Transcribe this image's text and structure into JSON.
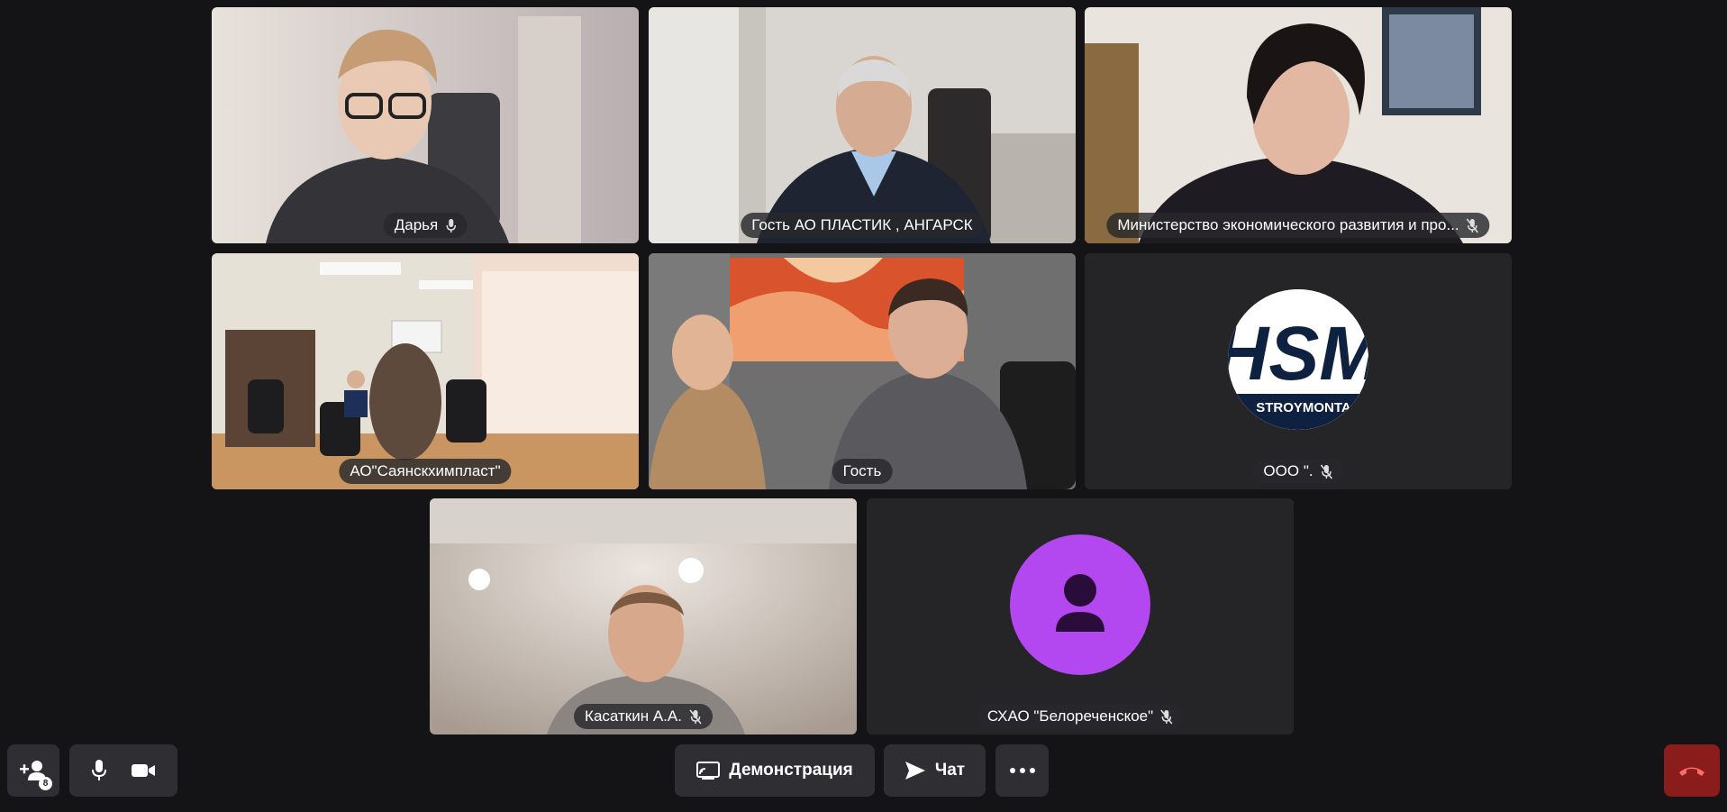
{
  "tiles": [
    {
      "name": "Дарья",
      "mic": "mic-on"
    },
    {
      "name": "Гость АО ПЛАСТИК , АНГАРСК",
      "mic": "none"
    },
    {
      "name": "Министерство экономического развития и про...",
      "mic": "mic-muted"
    },
    {
      "name": "АО\"Саянскхимпласт\"",
      "mic": "none"
    },
    {
      "name": "Гость",
      "mic": "none",
      "speaking": true
    },
    {
      "name": "ООО \".",
      "mic": "mic-muted",
      "avatar_logo_text": "HSM",
      "avatar_logo_subtext": "STROYMONTA"
    },
    {
      "name": "Касаткин А.А.",
      "mic": "mic-muted"
    },
    {
      "name": "СХАО \"Белореченское\"",
      "mic": "mic-muted",
      "avatar_color": "#b347f0"
    }
  ],
  "toolbar": {
    "participants_count": "8",
    "screen_share_label": "Демонстрация",
    "chat_label": "Чат",
    "active_speaker_color": "#f3c948",
    "end_call_color": "#8b1c1c"
  }
}
